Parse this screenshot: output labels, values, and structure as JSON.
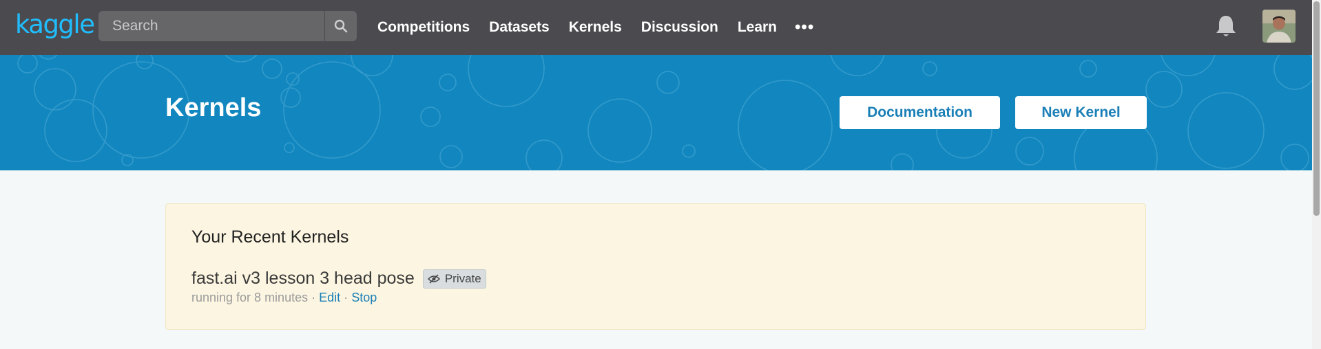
{
  "nav": {
    "logo": "kaggle",
    "search_placeholder": "Search",
    "links": [
      "Competitions",
      "Datasets",
      "Kernels",
      "Discussion",
      "Learn"
    ],
    "more": "•••",
    "icons": [
      "search-icon",
      "bell-icon",
      "avatar"
    ]
  },
  "hero": {
    "title": "Kernels",
    "documentation_label": "Documentation",
    "new_kernel_label": "New Kernel"
  },
  "recent": {
    "heading": "Your Recent Kernels",
    "kernel": {
      "title": "fast.ai v3 lesson 3 head pose",
      "badge": "Private",
      "status": "running for 8 minutes",
      "sep": "·",
      "edit": "Edit",
      "stop": "Stop"
    }
  },
  "colors": {
    "nav_bg": "#4b4b4f",
    "brand": "#20beff",
    "hero_bg": "#1287bf",
    "card_bg": "#fbf5e1",
    "link": "#1a7fb7"
  }
}
